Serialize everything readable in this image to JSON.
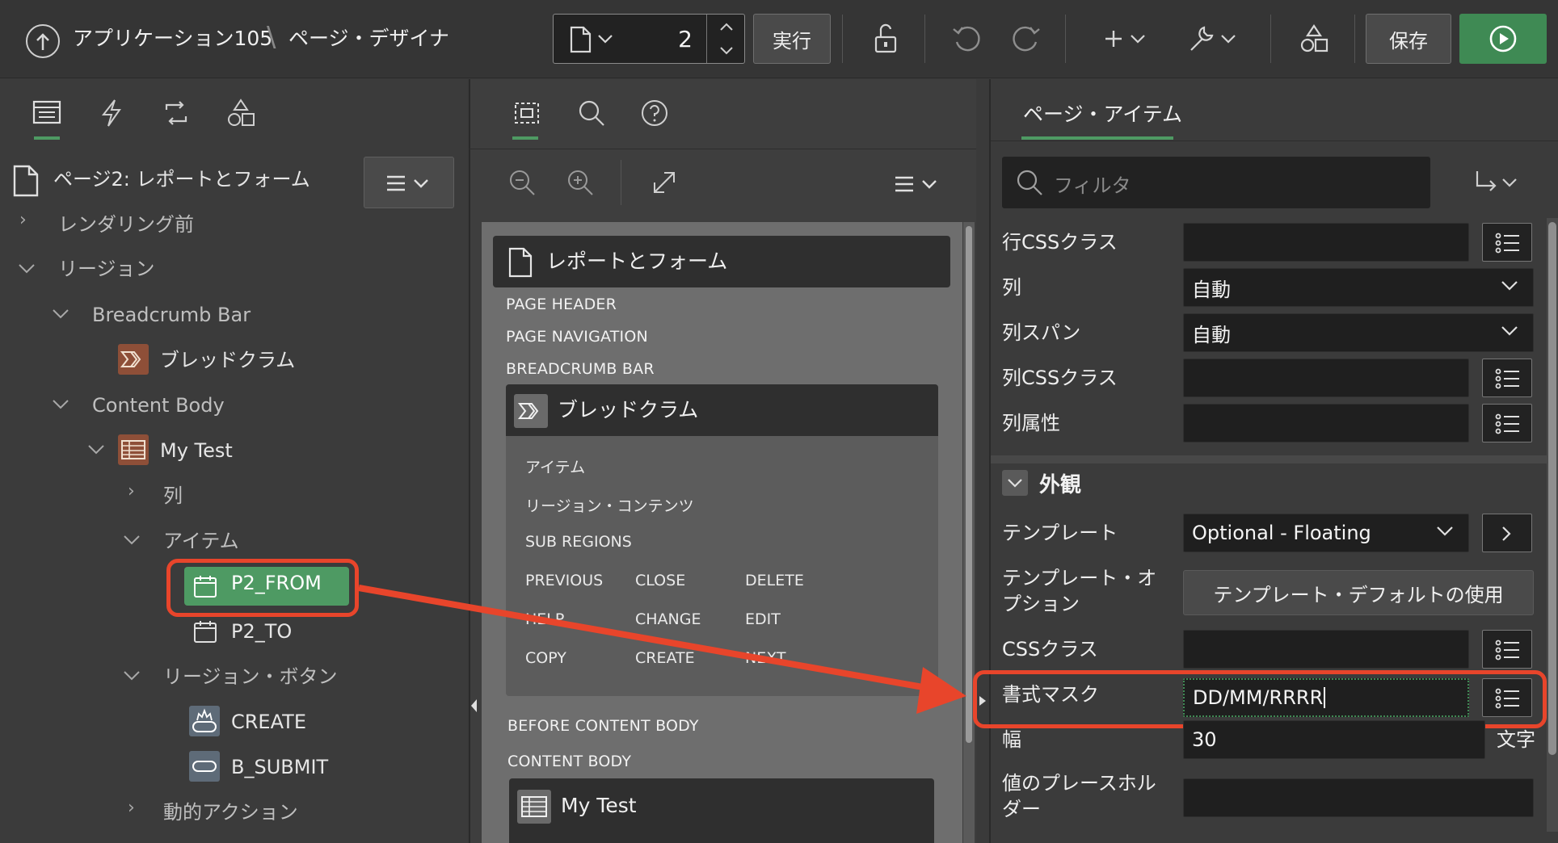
{
  "header": {
    "app_name": "アプリケーション105",
    "separator": "\\",
    "page_designer": "ページ・デザイナ",
    "page_number": "2",
    "run_label": "実行",
    "save_label": "保存"
  },
  "left": {
    "page_title": "ページ2: レポートとフォーム",
    "before_render": "レンダリング前",
    "regions": "リージョン",
    "breadcrumb_bar": "Breadcrumb Bar",
    "breadcrumb": "ブレッドクラム",
    "content_body": "Content Body",
    "my_test": "My Test",
    "columns": "列",
    "items": "アイテム",
    "item_from": "P2_FROM",
    "item_to": "P2_TO",
    "region_buttons": "リージョン・ボタン",
    "btn_create": "CREATE",
    "btn_submit": "B_SUBMIT",
    "dynamic_actions": "動的アクション"
  },
  "middle": {
    "page_region": "レポートとフォーム",
    "page_header": "PAGE HEADER",
    "page_navigation": "PAGE NAVIGATION",
    "breadcrumb_bar": "BREADCRUMB BAR",
    "breadcrumb": "ブレッドクラム",
    "sub_items": "アイテム",
    "sub_region_content": "リージョン・コンテンツ",
    "sub_regions": "SUB REGIONS",
    "grid": [
      "PREVIOUS",
      "CLOSE",
      "DELETE",
      "HELP",
      "CHANGE",
      "EDIT",
      "COPY",
      "CREATE",
      "NEXT"
    ],
    "before_content_body": "BEFORE CONTENT BODY",
    "content_body": "CONTENT BODY",
    "my_test": "My Test"
  },
  "right": {
    "tab": "ページ・アイテム",
    "filter_placeholder": "フィルタ",
    "row_css": "行CSSクラス",
    "column": "列",
    "column_value": "自動",
    "column_span": "列スパン",
    "column_span_value": "自動",
    "column_css": "列CSSクラス",
    "column_attr": "列属性",
    "appearance": "外観",
    "template": "テンプレート",
    "template_value": "Optional - Floating",
    "template_options": "テンプレート・オ\nプション",
    "template_default_btn": "テンプレート・デフォルトの使用",
    "css_classes": "CSSクラス",
    "format_mask": "書式マスク",
    "format_mask_value": "DD/MM/RRRR",
    "width": "幅",
    "width_value": "30",
    "width_unit": "文字",
    "placeholder": "値のプレースホル\nダー"
  },
  "colors": {
    "accent_green": "#4e9a63",
    "highlight_red": "#e8452b",
    "run_green": "#3f8a54"
  }
}
